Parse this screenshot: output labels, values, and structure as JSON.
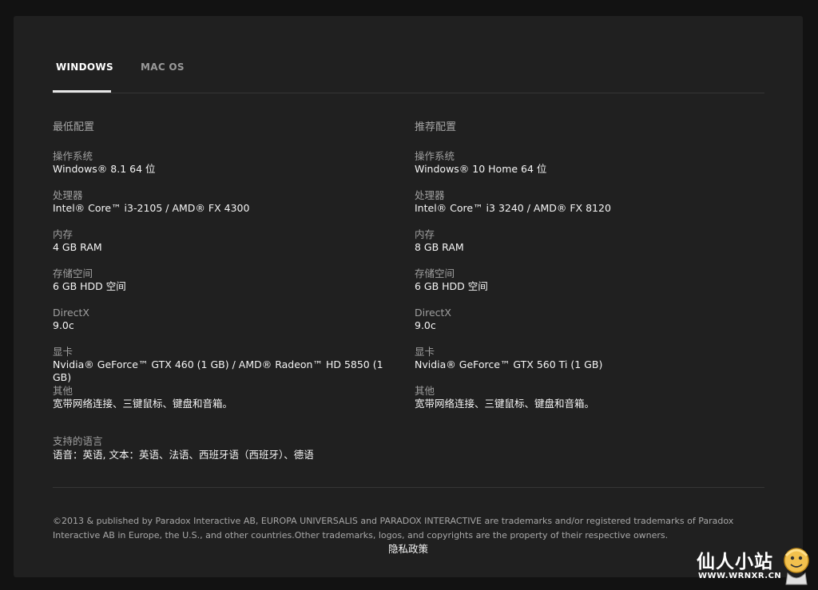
{
  "tabs": [
    {
      "label": "WINDOWS",
      "active": true
    },
    {
      "label": "MAC OS",
      "active": false
    }
  ],
  "minimum": {
    "title": "最低配置",
    "specs": [
      {
        "label": "操作系统",
        "value": "Windows® 8.1 64 位"
      },
      {
        "label": "处理器",
        "value": "Intel® Core™ i3-2105 / AMD® FX 4300"
      },
      {
        "label": "内存",
        "value": "4 GB RAM"
      },
      {
        "label": "存储空间",
        "value": "6 GB HDD 空间"
      },
      {
        "label": "DirectX",
        "value": "9.0c"
      },
      {
        "label": "显卡",
        "value": "Nvidia® GeForce™ GTX 460 (1 GB) / AMD® Radeon™ HD 5850 (1 GB)"
      },
      {
        "label": "其他",
        "value": "宽带网络连接、三键鼠标、键盘和音箱。"
      }
    ]
  },
  "recommended": {
    "title": "推荐配置",
    "specs": [
      {
        "label": "操作系统",
        "value": "Windows® 10 Home 64 位"
      },
      {
        "label": "处理器",
        "value": "Intel® Core™ i3 3240 / AMD® FX 8120"
      },
      {
        "label": "内存",
        "value": "8 GB RAM"
      },
      {
        "label": "存储空间",
        "value": "6 GB HDD 空间"
      },
      {
        "label": "DirectX",
        "value": "9.0c"
      },
      {
        "label": "显卡",
        "value": "Nvidia® GeForce™ GTX 560 Ti (1 GB)"
      },
      {
        "label": "其他",
        "value": "宽带网络连接、三键鼠标、键盘和音箱。"
      }
    ]
  },
  "languages": {
    "label": "支持的语言",
    "value": "语音：英语, 文本：英语、法语、西班牙语（西班牙）、德语"
  },
  "footer": {
    "copyright": "©2013 & published by Paradox Interactive AB, EUROPA UNIVERSALIS and PARADOX INTERACTIVE are trademarks and/or registered trademarks of Paradox Interactive AB in Europe, the U.S., and other countries.Other trademarks, logos, and copyrights are the property of their respective owners.",
    "privacy_link": "隐私政策"
  },
  "watermark": {
    "title": "仙人小站",
    "url": "WWW.WRNXR.CN"
  },
  "colors": {
    "page_bg": "#121212",
    "panel_bg": "#202020",
    "text_primary": "#f5f5f5",
    "text_secondary": "#9f9f9f",
    "divider": "#353535"
  }
}
